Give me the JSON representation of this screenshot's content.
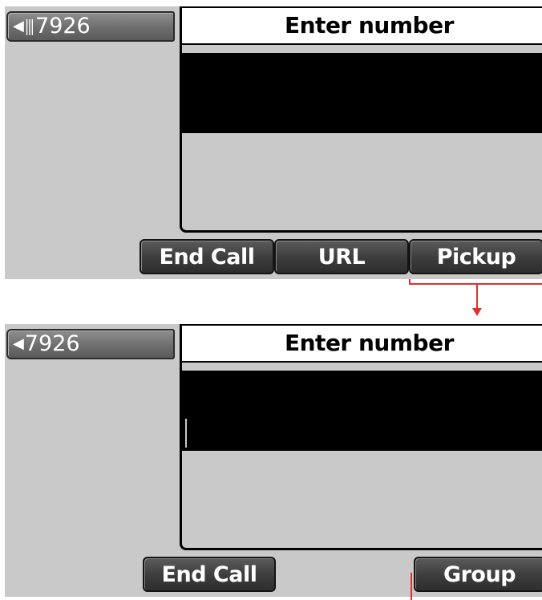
{
  "screens": [
    {
      "line_label": "7926",
      "title": "Enter number",
      "softkeys": [
        "End Call",
        "URL",
        "Pickup"
      ]
    },
    {
      "line_label": "7926",
      "title": "Enter number",
      "softkeys": [
        "End Call",
        "",
        "Group"
      ]
    }
  ],
  "colors": {
    "screen_background": "#c9c9c9",
    "entry_field": "#000000",
    "softkey": "#3c3c3c",
    "connector": "#e03030"
  },
  "icons": {
    "line_indicator": "left-arrow-with-signal-bars-icon",
    "line_indicator_short": "left-arrow-icon",
    "flow_arrow": "down-arrow-icon"
  }
}
